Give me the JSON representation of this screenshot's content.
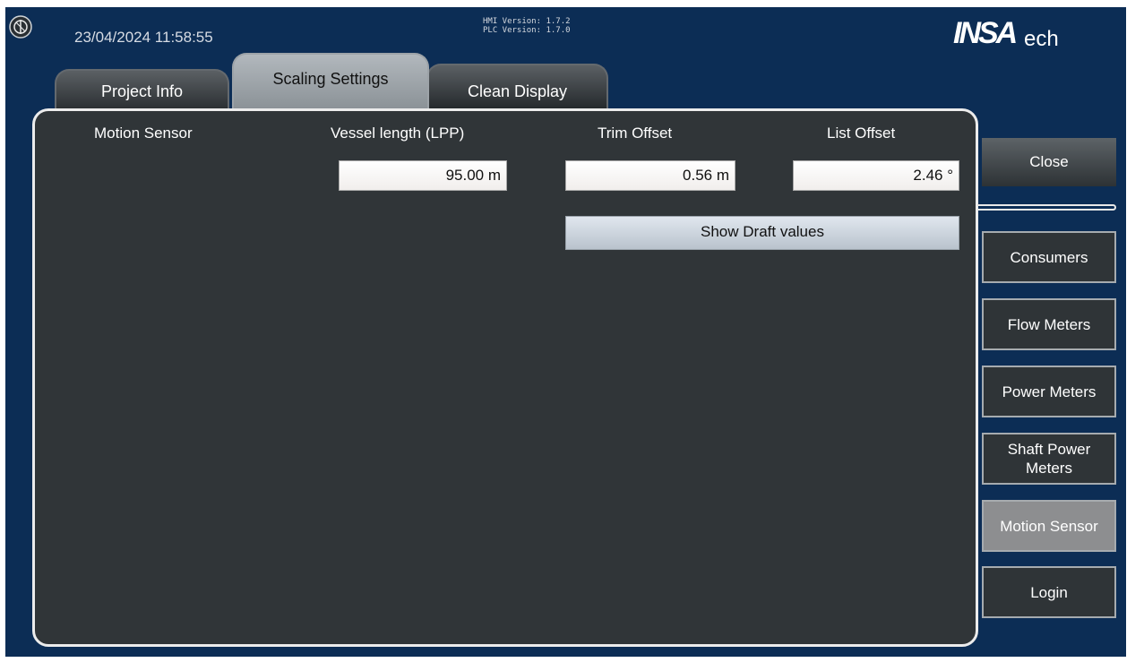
{
  "header": {
    "datetime": "23/04/2024 11:58:55",
    "hmi_version": "HMI Version: 1.7.2",
    "plc_version": "PLC Version: 1.7.0",
    "logo_brand": "INSA",
    "logo_suffix": "ech"
  },
  "tabs": [
    {
      "label": "Project Info",
      "active": false
    },
    {
      "label": "Scaling Settings",
      "active": true
    },
    {
      "label": "Clean Display",
      "active": false
    }
  ],
  "panel": {
    "section_title": "Motion Sensor",
    "fields": [
      {
        "label": "Vessel length (LPP)",
        "value": "95.00 m"
      },
      {
        "label": "Trim Offset",
        "value": "0.56 m"
      },
      {
        "label": "List Offset",
        "value": "2.46 °"
      }
    ],
    "show_draft_button": "Show Draft values"
  },
  "sidebar": {
    "close_label": "Close",
    "items": [
      {
        "label": "Consumers",
        "active": false
      },
      {
        "label": "Flow Meters",
        "active": false
      },
      {
        "label": "Power Meters",
        "active": false
      },
      {
        "label": "Shaft Power Meters",
        "active": false
      },
      {
        "label": "Motion Sensor",
        "active": true
      },
      {
        "label": "Login",
        "active": false
      }
    ]
  },
  "colors": {
    "background": "#0c2d55",
    "panel": "#303538",
    "active_nav": "#8d8e90"
  }
}
